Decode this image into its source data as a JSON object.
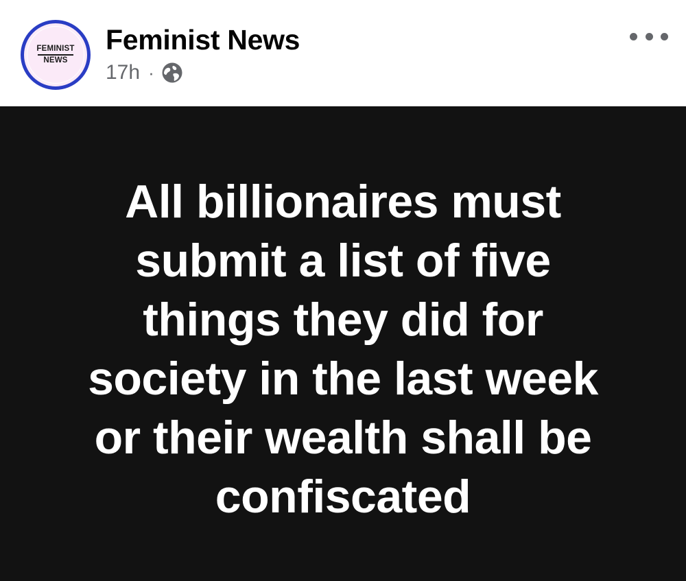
{
  "post": {
    "page_name": "Feminist News",
    "timestamp": "17h",
    "separator": "·",
    "audience_icon": "globe-icon",
    "more_icon": "more-options-icon",
    "avatar": {
      "line1": "FEMINIST",
      "line2": "NEWS",
      "border_color": "#2a3dc4",
      "fill_color": "#fbeaf8"
    },
    "content": {
      "background_color": "#121212",
      "text_color": "#ffffff",
      "lines": [
        "All billionaires must",
        "submit a list of five",
        "things they did for",
        "society in the last week",
        "or their wealth shall be",
        "confiscated"
      ]
    }
  }
}
